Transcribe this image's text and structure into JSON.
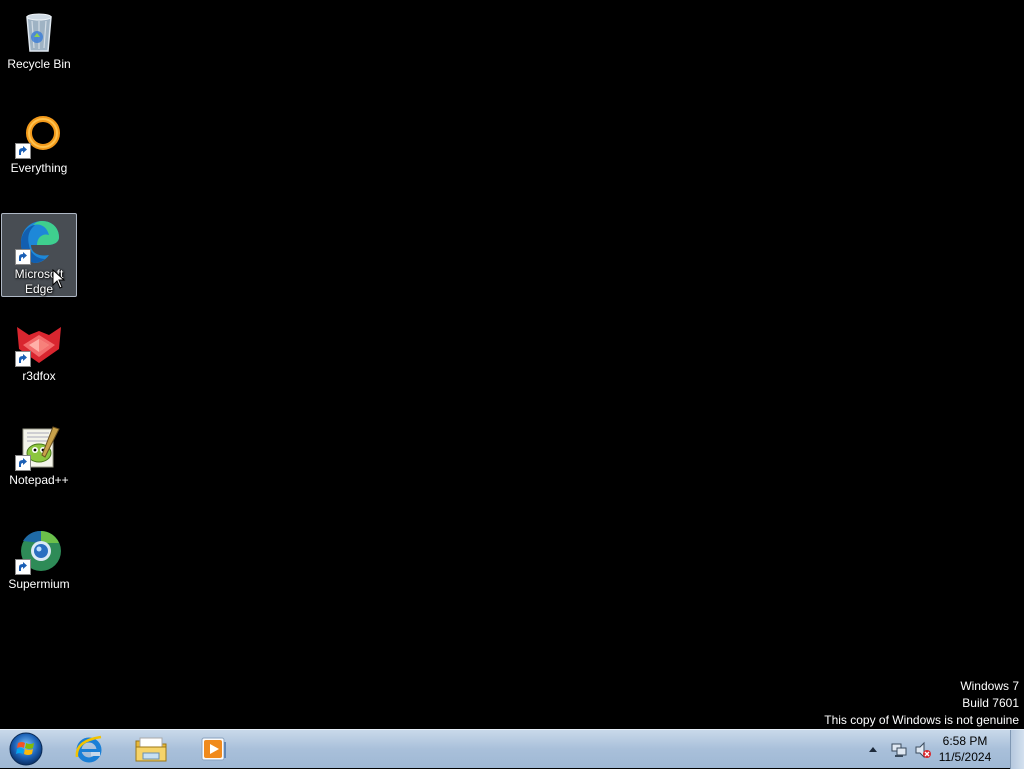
{
  "desktop": {
    "icons": [
      {
        "name": "recycle-bin-icon",
        "label": "Recycle Bin"
      },
      {
        "name": "everything-icon",
        "label": "Everything"
      },
      {
        "name": "microsoft-edge-icon",
        "label": "Microsoft Edge"
      },
      {
        "name": "r3dfox-icon",
        "label": "r3dfox"
      },
      {
        "name": "notepad-plus-plus-icon",
        "label": "Notepad++"
      },
      {
        "name": "supermium-icon",
        "label": "Supermium"
      }
    ],
    "selected_icon": "Microsoft Edge"
  },
  "watermark": {
    "line1": "Windows 7",
    "line2": "Build 7601",
    "line3": "This copy of Windows is not genuine"
  },
  "taskbar": {
    "start_icon": "windows-start-orb-icon",
    "pinned": [
      "internet-explorer-icon",
      "windows-explorer-icon",
      "media-player-icon"
    ],
    "tray_icons": [
      "show-hidden-icons-arrow",
      "network-icon",
      "volume-muted-icon"
    ],
    "clock_time": "6:58 PM",
    "clock_date": "11/5/2024"
  },
  "colors": {
    "desktop_background": "#000000",
    "taskbar": "#a9c0da",
    "edge_accent": "#2fa4e0",
    "everything_accent": "#f39a1b",
    "r3dfox_accent": "#e0343f"
  }
}
